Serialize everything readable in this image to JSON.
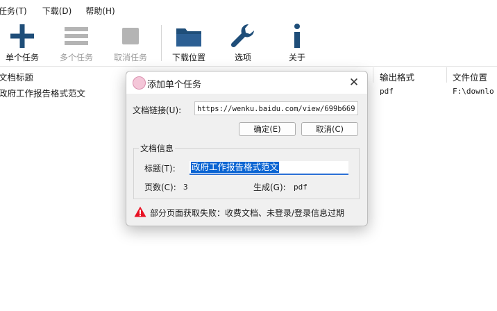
{
  "menubar": {
    "items": [
      "任务(T)",
      "下载(D)",
      "帮助(H)"
    ]
  },
  "toolbar": {
    "buttons": [
      {
        "label": "单个任务",
        "icon": "plus-icon",
        "enabled": true
      },
      {
        "label": "多个任务",
        "icon": "list-icon",
        "enabled": false
      },
      {
        "label": "取消任务",
        "icon": "stop-icon",
        "enabled": false
      },
      {
        "label": "下载位置",
        "icon": "folder-icon",
        "enabled": true
      },
      {
        "label": "选项",
        "icon": "wrench-icon",
        "enabled": true
      },
      {
        "label": "关于",
        "icon": "info-icon",
        "enabled": true
      }
    ]
  },
  "table": {
    "columns": [
      "文档标题",
      "输出格式",
      "文件位置"
    ],
    "rows": [
      {
        "title": "政府工作报告格式范文",
        "format": "pdf",
        "location": "F:\\downlo"
      }
    ]
  },
  "dialog": {
    "title": "添加单个任务",
    "close": "✕",
    "url_label": "文档链接(U):",
    "url_value": "https://wenku.baidu.com/view/699b669",
    "confirm_label": "确定(E)",
    "cancel_label": "取消(C)",
    "group_title": "文档信息",
    "title_label": "标题(T):",
    "title_value": "政府工作报告格式范文",
    "pages_label": "页数(C):",
    "pages_value": "3",
    "output_label": "生成(G):",
    "output_value": "pdf",
    "warning": "部分页面获取失败：收费文档、未登录/登录信息过期",
    "warning_color": "#e81123",
    "accent": "#0a64d2"
  },
  "colors": {
    "icon_dark": "#1f4e79",
    "icon_disabled": "#b4b4b4"
  }
}
